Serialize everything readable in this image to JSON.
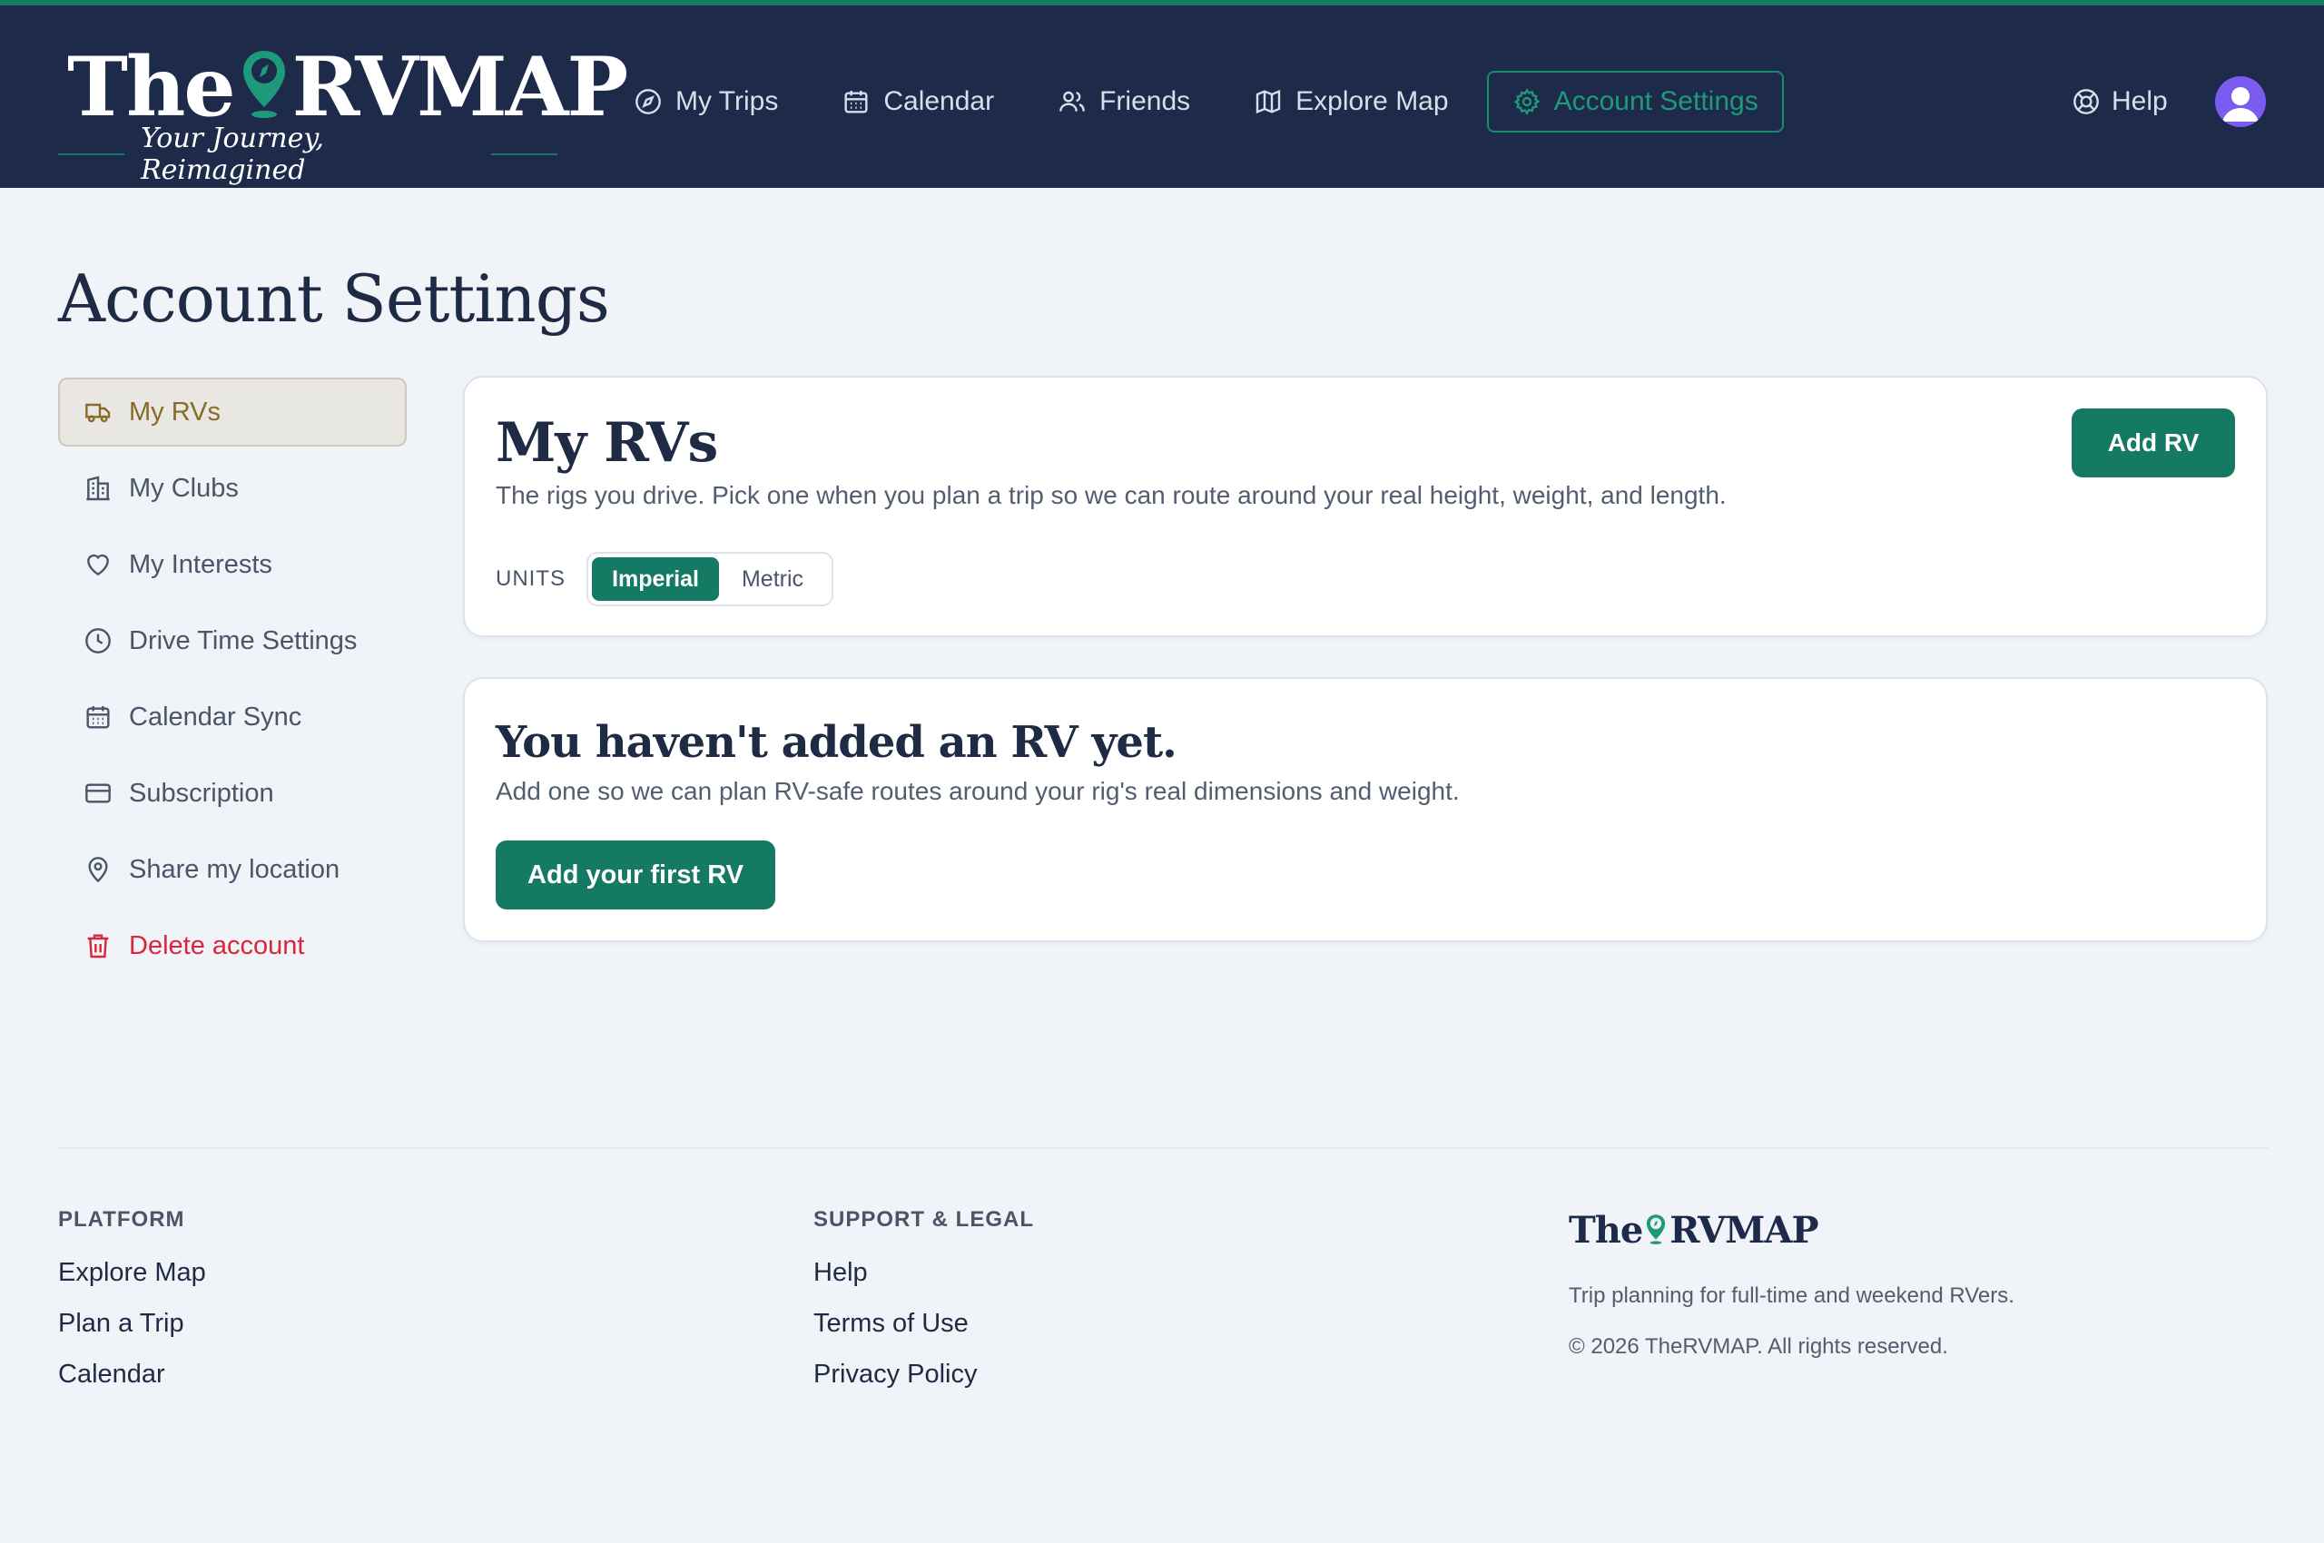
{
  "brand": {
    "the": "The",
    "name": "RVMAP",
    "tagline": "Your Journey, Reimagined",
    "accent": "#157a63",
    "navy": "#1d2a4a"
  },
  "nav": {
    "items": [
      {
        "label": "My Trips",
        "icon": "compass-icon"
      },
      {
        "label": "Calendar",
        "icon": "calendar-icon"
      },
      {
        "label": "Friends",
        "icon": "users-icon"
      },
      {
        "label": "Explore Map",
        "icon": "map-icon"
      },
      {
        "label": "Account Settings",
        "icon": "gear-icon",
        "active": true
      }
    ],
    "help": "Help"
  },
  "page": {
    "title": "Account Settings"
  },
  "sidebar": {
    "items": [
      {
        "label": "My RVs",
        "icon": "truck-icon",
        "active": true
      },
      {
        "label": "My Clubs",
        "icon": "building-icon"
      },
      {
        "label": "My Interests",
        "icon": "heart-icon"
      },
      {
        "label": "Drive Time Settings",
        "icon": "clock-icon"
      },
      {
        "label": "Calendar Sync",
        "icon": "calendar-icon"
      },
      {
        "label": "Subscription",
        "icon": "credit-card-icon"
      },
      {
        "label": "Share my location",
        "icon": "map-pin-icon"
      },
      {
        "label": "Delete account",
        "icon": "trash-icon",
        "danger": true
      }
    ]
  },
  "rvs_card": {
    "title": "My RVs",
    "description": "The rigs you drive. Pick one when you plan a trip so we can route around your real height, weight, and length.",
    "add_button": "Add RV",
    "units_label": "UNITS",
    "units_options": [
      "Imperial",
      "Metric"
    ],
    "units_selected": "Imperial"
  },
  "empty_card": {
    "title": "You haven't added an RV yet.",
    "description": "Add one so we can plan RV-safe routes around your rig's real dimensions and weight.",
    "button": "Add your first RV"
  },
  "footer": {
    "platform": {
      "heading": "PLATFORM",
      "links": [
        "Explore Map",
        "Plan a Trip",
        "Calendar"
      ]
    },
    "support": {
      "heading": "SUPPORT & LEGAL",
      "links": [
        "Help",
        "Terms of Use",
        "Privacy Policy"
      ]
    },
    "tagline": "Trip planning for full-time and weekend RVers.",
    "copyright": "© 2026 TheRVMAP. All rights reserved."
  }
}
